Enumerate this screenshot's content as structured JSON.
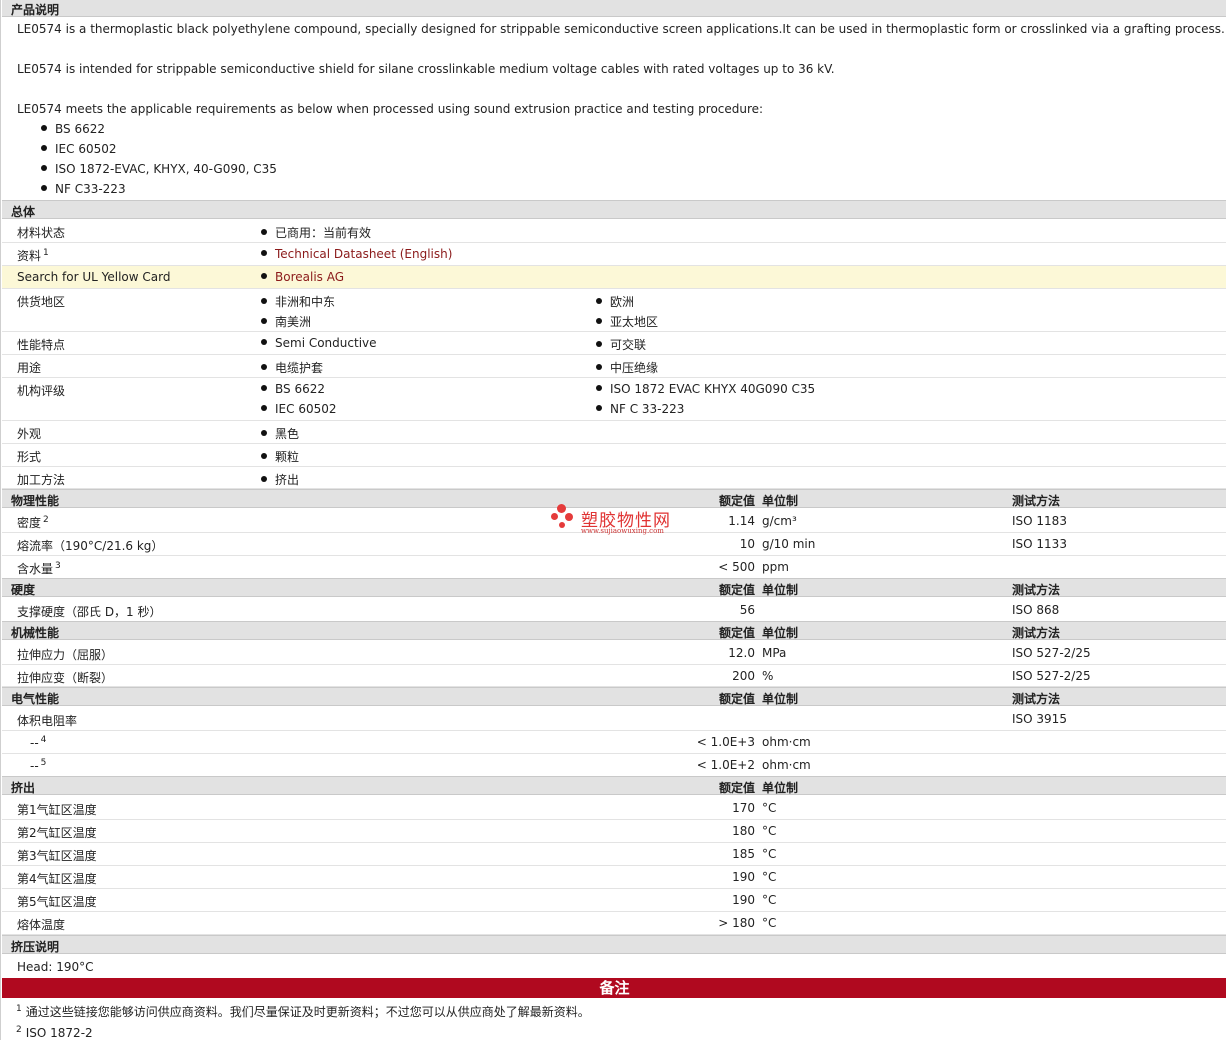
{
  "sections": {
    "desc": "产品说明",
    "general": "总体",
    "physical": "物理性能",
    "hardness": "硬度",
    "mechanical": "机械性能",
    "electrical": "电气性能",
    "extrusion": "挤出",
    "extrusion_notes": "挤压说明"
  },
  "col_headers": {
    "value": "额定值",
    "unit": "单位制",
    "test": "测试方法"
  },
  "description": {
    "p1": "LE0574 is a thermoplastic black polyethylene compound, specially designed for strippable semiconductive screen applications.It can be used in thermoplastic form or crosslinked via a grafting process.",
    "p2": "LE0574 is intended for strippable semiconductive shield for silane crosslinkable medium voltage cables with rated voltages up to 36 kV.",
    "p3": "LE0574 meets the applicable requirements as below when processed using sound extrusion practice and testing procedure:",
    "standards": [
      "BS 6622",
      "IEC 60502",
      "ISO 1872-EVAC, KHYX, 40-G090, C35",
      "NF C33-223"
    ]
  },
  "general": {
    "status_label": "材料状态",
    "status_value": "已商用：当前有效",
    "docs_label": "资料",
    "docs_sup": "1",
    "docs_link": "Technical Datasheet (English)",
    "ul_label": "Search for UL Yellow Card",
    "ul_link": "Borealis AG",
    "regions_label": "供货地区",
    "regions": [
      "非洲和中东",
      "欧洲",
      "南美洲",
      "亚太地区"
    ],
    "features_label": "性能特点",
    "features": [
      "Semi Conductive",
      "可交联"
    ],
    "uses_label": "用途",
    "uses": [
      "电缆护套",
      "中压绝缘"
    ],
    "agency_label": "机构评级",
    "agency": [
      "BS 6622",
      "ISO 1872 EVAC KHYX 40G090 C35",
      "IEC 60502",
      "NF C 33-223"
    ],
    "appearance_label": "外观",
    "appearance": "黑色",
    "form_label": "形式",
    "form": "颗粒",
    "process_label": "加工方法",
    "process": "挤出"
  },
  "physical": [
    {
      "label": "密度",
      "sup": "2",
      "value": "1.14",
      "unit": "g/cm³",
      "test": "ISO 1183"
    },
    {
      "label": "熔流率（190°C/21.6 kg）",
      "sup": "",
      "value": "10",
      "unit": "g/10 min",
      "test": "ISO 1133"
    },
    {
      "label": "含水量",
      "sup": "3",
      "value": "< 500",
      "unit": "ppm",
      "test": ""
    }
  ],
  "hardness": [
    {
      "label": "支撑硬度（邵氏 D，1 秒）",
      "value": "56",
      "unit": "",
      "test": "ISO 868"
    }
  ],
  "mechanical": [
    {
      "label": "拉伸应力（屈服）",
      "value": "12.0",
      "unit": "MPa",
      "test": "ISO 527-2/25"
    },
    {
      "label": "拉伸应变（断裂）",
      "value": "200",
      "unit": "%",
      "test": "ISO 527-2/25"
    }
  ],
  "electrical": {
    "main_label": "体积电阻率",
    "main_test": "ISO 3915",
    "rows": [
      {
        "label": "--",
        "sup": "4",
        "value": "< 1.0E+3",
        "unit": "ohm·cm"
      },
      {
        "label": "--",
        "sup": "5",
        "value": "< 1.0E+2",
        "unit": "ohm·cm"
      }
    ]
  },
  "extrusion": [
    {
      "label": "第1气缸区温度",
      "value": "170",
      "unit": "°C"
    },
    {
      "label": "第2气缸区温度",
      "value": "180",
      "unit": "°C"
    },
    {
      "label": "第3气缸区温度",
      "value": "185",
      "unit": "°C"
    },
    {
      "label": "第4气缸区温度",
      "value": "190",
      "unit": "°C"
    },
    {
      "label": "第5气缸区温度",
      "value": "190",
      "unit": "°C"
    },
    {
      "label": "熔体温度",
      "value": "> 180",
      "unit": "°C"
    }
  ],
  "extrusion_note": "Head: 190°C",
  "notes_banner": "备注",
  "footnotes": [
    {
      "num": "1",
      "text": "通过这些链接您能够访问供应商资料。我们尽量保证及时更新资料；不过您可以从供应商处了解最新资料。"
    },
    {
      "num": "2",
      "text": "ISO 1872-2"
    }
  ],
  "watermark": {
    "title": "塑胶物性网",
    "url": "www.sujiaowuxing.com"
  }
}
